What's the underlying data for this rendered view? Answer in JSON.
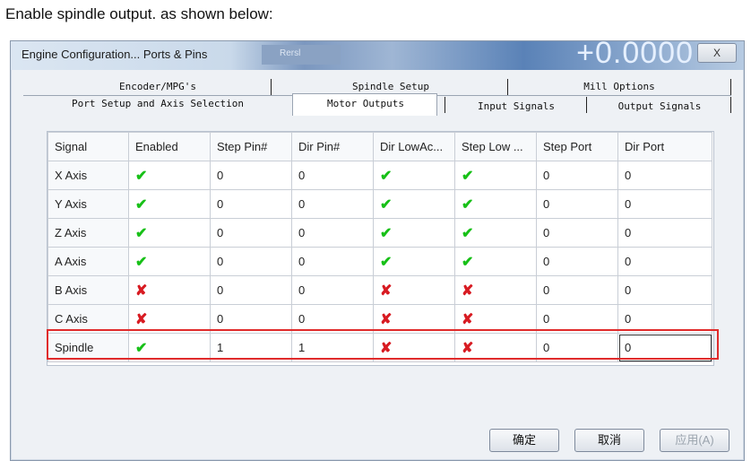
{
  "caption": "Enable spindle output. as shown below:",
  "window": {
    "title": "Engine Configuration... Ports & Pins",
    "bg_number": "+0.0000",
    "bg_chip": "Rersl",
    "close_label": "X"
  },
  "tabs": {
    "row1": [
      "Encoder/MPG's",
      "Spindle Setup",
      "Mill Options"
    ],
    "row2": [
      "Port Setup and Axis Selection",
      "Motor Outputs",
      "Input Signals",
      "Output Signals"
    ],
    "active": "Motor Outputs"
  },
  "table": {
    "columns": [
      "Signal",
      "Enabled",
      "Step Pin#",
      "Dir Pin#",
      "Dir LowAc...",
      "Step Low ...",
      "Step Port",
      "Dir Port"
    ],
    "rows": [
      {
        "signal": "X Axis",
        "enabled": "check",
        "step_pin": "0",
        "dir_pin": "0",
        "dir_low": "check",
        "step_low": "check",
        "step_port": "0",
        "dir_port": "0"
      },
      {
        "signal": "Y Axis",
        "enabled": "check",
        "step_pin": "0",
        "dir_pin": "0",
        "dir_low": "check",
        "step_low": "check",
        "step_port": "0",
        "dir_port": "0"
      },
      {
        "signal": "Z Axis",
        "enabled": "check",
        "step_pin": "0",
        "dir_pin": "0",
        "dir_low": "check",
        "step_low": "check",
        "step_port": "0",
        "dir_port": "0"
      },
      {
        "signal": "A Axis",
        "enabled": "check",
        "step_pin": "0",
        "dir_pin": "0",
        "dir_low": "check",
        "step_low": "check",
        "step_port": "0",
        "dir_port": "0"
      },
      {
        "signal": "B Axis",
        "enabled": "cross",
        "step_pin": "0",
        "dir_pin": "0",
        "dir_low": "cross",
        "step_low": "cross",
        "step_port": "0",
        "dir_port": "0"
      },
      {
        "signal": "C Axis",
        "enabled": "cross",
        "step_pin": "0",
        "dir_pin": "0",
        "dir_low": "cross",
        "step_low": "cross",
        "step_port": "0",
        "dir_port": "0"
      },
      {
        "signal": "Spindle",
        "enabled": "check",
        "step_pin": "1",
        "dir_pin": "1",
        "dir_low": "cross",
        "step_low": "cross",
        "step_port": "0",
        "dir_port": "0"
      }
    ]
  },
  "buttons": {
    "ok": "确定",
    "cancel": "取消",
    "apply": "应用(A)"
  },
  "icons": {
    "check": "✔",
    "cross": "✘"
  },
  "colors": {
    "check": "#17c017",
    "cross": "#d81b22",
    "highlight": "#e02b2b"
  }
}
